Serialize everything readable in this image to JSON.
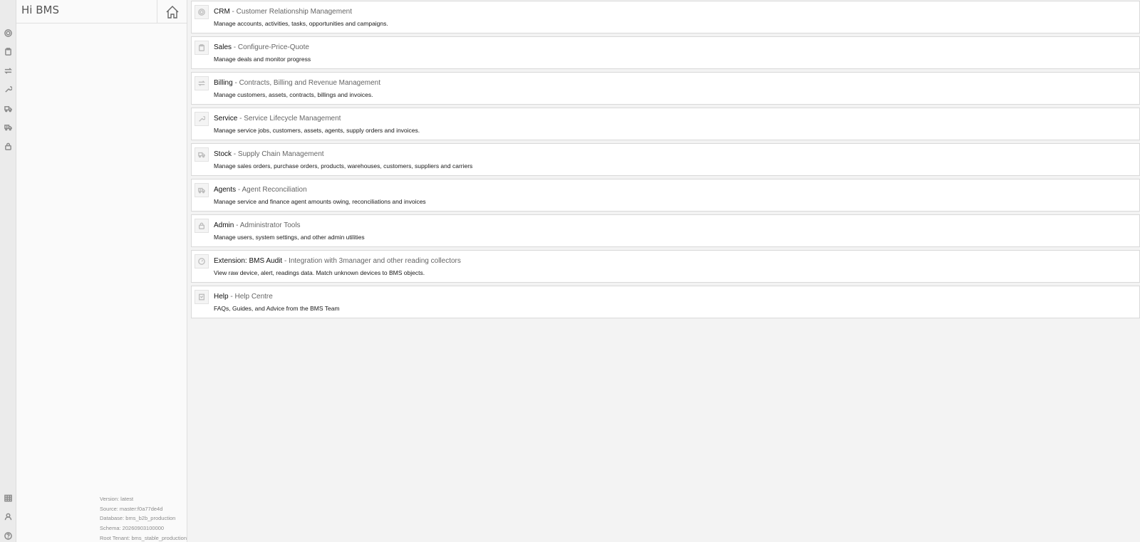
{
  "sidebar": {
    "title": "Hi BMS",
    "home_icon": "home-icon",
    "version_info": [
      "Version: latest",
      "Source: master:f0a77de4d",
      "Database: bms_b2b_production",
      "Schema: 20260903100000",
      "Root Tenant: bms_stable_production"
    ]
  },
  "rail": {
    "top_icons": [
      "target-icon",
      "clipboard-icon",
      "repeat-icon",
      "wrench-icon",
      "truck-icon",
      "truck-dollar-icon",
      "lock-icon"
    ],
    "bottom_icons": [
      "table-icon",
      "user-icon",
      "help-icon"
    ]
  },
  "modules": [
    {
      "name": "CRM",
      "separator": " - ",
      "subtitle": "Customer Relationship Management",
      "description": "Manage accounts, activities, tasks, opportunities and campaigns.",
      "icon": "target-icon"
    },
    {
      "name": "Sales",
      "separator": " - ",
      "subtitle": "Configure-Price-Quote",
      "description": "Manage deals and monitor progress",
      "icon": "clipboard-icon"
    },
    {
      "name": "Billing",
      "separator": " - ",
      "subtitle": "Contracts, Billing and Revenue Management",
      "description": "Manage customers, assets, contracts, billings and invoices.",
      "icon": "repeat-icon"
    },
    {
      "name": "Service",
      "separator": " - ",
      "subtitle": "Service Lifecycle Management",
      "description": "Manage service jobs, customers, assets, agents, supply orders and invoices.",
      "icon": "wrench-icon"
    },
    {
      "name": "Stock",
      "separator": " - ",
      "subtitle": "Supply Chain Management",
      "description": "Manage sales orders, purchase orders, products, warehouses, customers, suppliers and carriers",
      "icon": "truck-icon"
    },
    {
      "name": "Agents",
      "separator": " - ",
      "subtitle": "Agent Reconciliation",
      "description": "Manage service and finance agent amounts owing, reconciliations and invoices",
      "icon": "truck-dollar-icon"
    },
    {
      "name": "Admin",
      "separator": " - ",
      "subtitle": "Administrator Tools",
      "description": "Manage users, system settings, and other admin utilities",
      "icon": "lock-icon"
    },
    {
      "name": "Extension: BMS Audit",
      "separator": " - ",
      "subtitle": "Integration with 3manager and other reading collectors",
      "description": "View raw device, alert, readings data. Match unknown devices to BMS objects.",
      "icon": "gauge-icon"
    },
    {
      "name": "Help",
      "separator": " - ",
      "subtitle": "Help Centre",
      "description": "FAQs, Guides, and Advice from the BMS Team",
      "icon": "help-doc-icon"
    }
  ]
}
